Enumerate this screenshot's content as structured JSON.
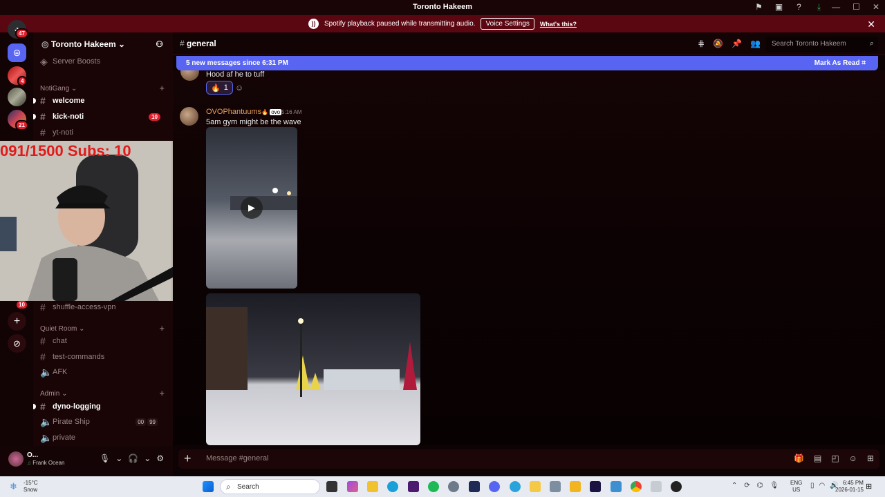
{
  "window": {
    "title": "Toronto Hakeem"
  },
  "notice": {
    "text": "Spotify playback paused while transmitting audio.",
    "button": "Voice Settings",
    "link": "What's this?"
  },
  "rail": {
    "home_badge": "47",
    "badges": [
      "4",
      "21"
    ],
    "sidebar_badge": "10"
  },
  "server": {
    "name": "Toronto Hakeem",
    "boosts": "Server Boosts"
  },
  "categories": [
    {
      "name": "NotiGang",
      "channels": [
        {
          "name": "welcome",
          "unread": true
        },
        {
          "name": "kick-noti",
          "unread": true,
          "mentions": "10"
        },
        {
          "name": "yt-noti",
          "unread": false
        }
      ]
    },
    {
      "name": "Quiet Room",
      "channels": [
        {
          "name": "chat"
        },
        {
          "name": "test-commands"
        },
        {
          "name": "AFK"
        }
      ]
    },
    {
      "name": "Admin",
      "channels": [
        {
          "name": "dyno-logging",
          "unread": true
        },
        {
          "name": "Pirate Ship",
          "voice_counts": [
            "00",
            "99"
          ]
        },
        {
          "name": "private"
        }
      ]
    }
  ],
  "hidden_channel": "shuffle-access-vpn",
  "user": {
    "name": "O...",
    "activity": "Frank Ocean"
  },
  "webcam": {
    "overlay_text": "091/1500  Subs: 10"
  },
  "channel": {
    "name": "general",
    "search_placeholder": "Search Toronto Hakeem"
  },
  "new_messages": {
    "text": "5 new messages since 6:31 PM",
    "action": "Mark As Read"
  },
  "messages": [
    {
      "text": "Hood af he to tuff",
      "reaction": {
        "emoji": "🔥",
        "count": "1"
      }
    },
    {
      "author": "OVOPhantuums",
      "tag": "ovo",
      "time": "5:16 AM",
      "text": "5am gym might be the wave"
    }
  ],
  "composer": {
    "placeholder": "Message #general"
  },
  "taskbar": {
    "weather_temp": "-15°C",
    "weather_desc": "Snow",
    "search": "Search",
    "lang": "ENG",
    "region": "US",
    "time": "6:45 PM",
    "date": "2026-01-15"
  }
}
